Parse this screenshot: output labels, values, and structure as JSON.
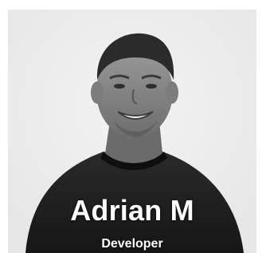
{
  "profile": {
    "name": "Adrian M",
    "role": "Developer",
    "photo_icon": "person-portrait"
  },
  "colors": {
    "background": "#efefef",
    "shirt": "#1f1f1f",
    "text": "#ffffff"
  }
}
